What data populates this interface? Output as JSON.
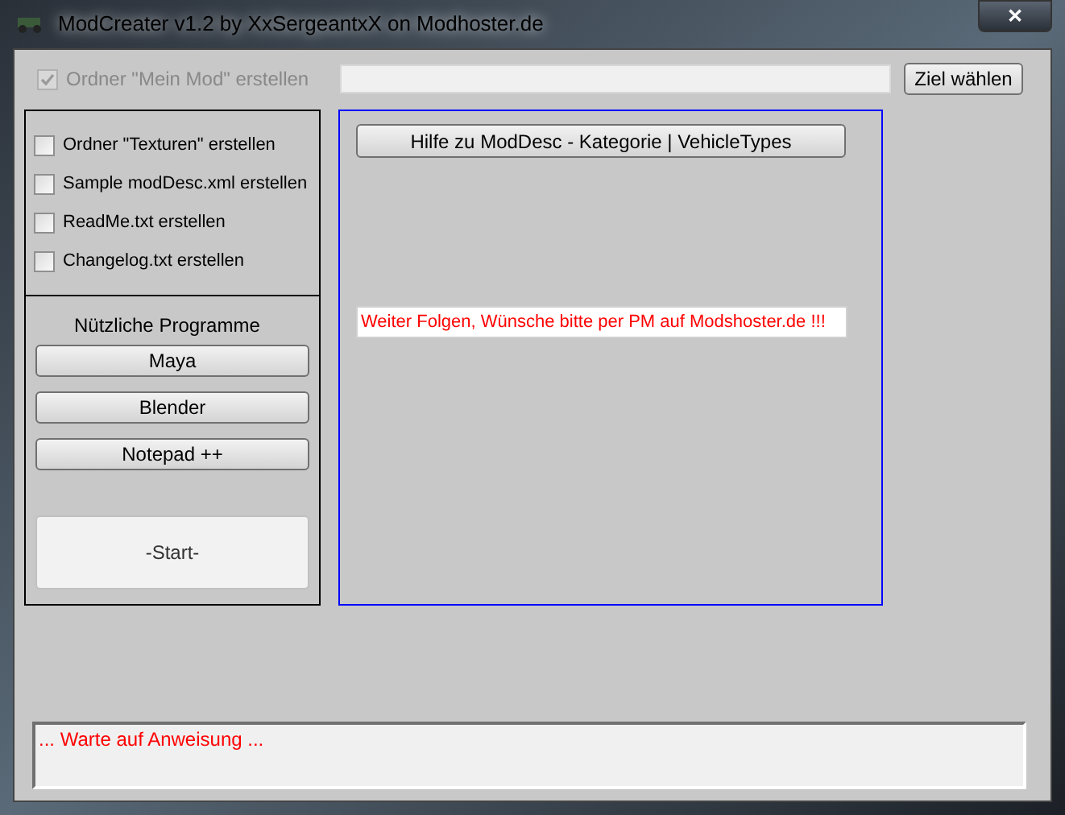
{
  "window": {
    "title": "ModCreater v1.2 by XxSergeantxX on Modhoster.de",
    "close": "✕"
  },
  "main_folder": {
    "label": "Ordner \"Mein Mod\" erstellen",
    "checked": true,
    "disabled": true
  },
  "target_button": "Ziel wählen",
  "options": [
    {
      "label": "Ordner \"Texturen\" erstellen",
      "checked": false
    },
    {
      "label": "Sample modDesc.xml erstellen",
      "checked": false
    },
    {
      "label": "ReadMe.txt erstellen",
      "checked": false
    },
    {
      "label": "Changelog.txt erstellen",
      "checked": false
    }
  ],
  "programs": {
    "title": "Nützliche Programme",
    "buttons": [
      "Maya",
      "Blender",
      "Notepad ++"
    ]
  },
  "start_button": "-Start-",
  "help_button": "Hilfe zu ModDesc - Kategorie | VehicleTypes",
  "notice": "Weiter Folgen, Wünsche bitte per PM auf Modshoster.de !!!",
  "status": "... Warte auf Anweisung ..."
}
